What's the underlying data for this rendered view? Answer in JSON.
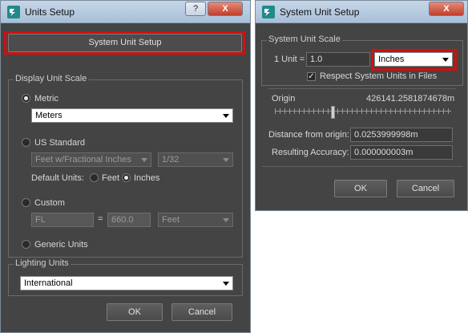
{
  "units_setup": {
    "title": "Units Setup",
    "help_label": "?",
    "close_label": "X",
    "system_unit_setup_button": "System Unit Setup",
    "display_unit_scale": {
      "label": "Display Unit Scale",
      "metric_label": "Metric",
      "metric_value": "Meters",
      "us_standard_label": "US Standard",
      "us_units_value": "Feet w/Fractional Inches",
      "us_fraction_value": "1/32",
      "default_units_label": "Default Units:",
      "feet_label": "Feet",
      "inches_label": "Inches",
      "custom_label": "Custom",
      "custom_name_value": "FL",
      "equals_label": "=",
      "custom_amount_value": "660.0",
      "custom_unit_value": "Feet",
      "generic_label": "Generic Units"
    },
    "lighting_units": {
      "label": "Lighting Units",
      "value": "International"
    },
    "ok_label": "OK",
    "cancel_label": "Cancel"
  },
  "system_unit_setup": {
    "title": "System Unit Setup",
    "close_label": "X",
    "scale_label": "System Unit Scale",
    "unit_label": "1 Unit =",
    "unit_value": "1.0",
    "unit_type_value": "Inches",
    "respect_label": "Respect System Units in Files",
    "respect_checked": true,
    "origin_label": "Origin",
    "origin_value": "426141.2581874678m",
    "distance_label": "Distance from origin:",
    "distance_value": "0.0253999998m",
    "accuracy_label": "Resulting Accuracy:",
    "accuracy_value": "0.000000003m",
    "ok_label": "OK",
    "cancel_label": "Cancel"
  },
  "colors": {
    "dialog_bg": "#444444",
    "highlight_red": "#d01010",
    "titlebar": "#b8cbe0"
  }
}
